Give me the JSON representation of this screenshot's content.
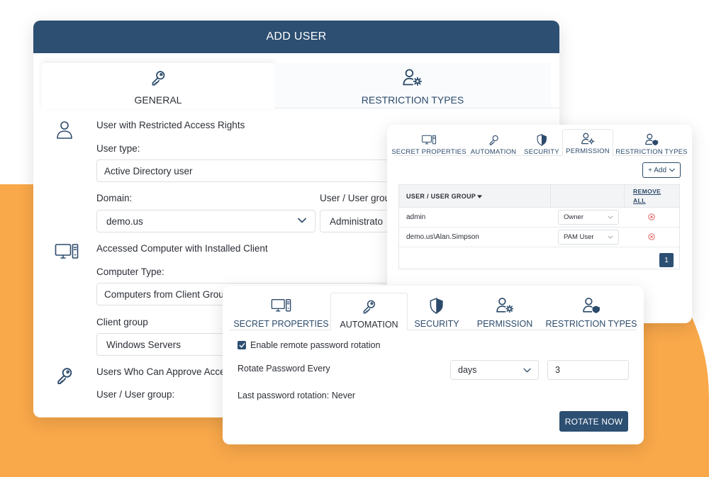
{
  "add_user": {
    "title": "ADD USER",
    "tabs": [
      {
        "label": "GENERAL",
        "icon": "key-icon",
        "active": true
      },
      {
        "label": "RESTRICTION TYPES",
        "icon": "user-gear-icon",
        "active": false
      }
    ],
    "section_user": {
      "heading": "User with Restricted Access Rights",
      "user_type_label": "User type:",
      "user_type_value": "Active Directory user",
      "domain_label": "Domain:",
      "domain_value": "demo.us",
      "user_group_label": "User / User grou",
      "user_group_value": "Administrato"
    },
    "section_computer": {
      "heading": "Accessed Computer with Installed Client",
      "computer_type_label": "Computer Type:",
      "computer_type_value": "Computers from Client Grou",
      "client_group_label": "Client group",
      "client_group_value": "Windows Servers"
    },
    "section_approvers": {
      "heading": "Users Who Can Approve Acce",
      "user_group_label": "User / User group:"
    }
  },
  "permissions": {
    "tabs": [
      {
        "label": "SECRET PROPERTIES",
        "icon": "computer-icon"
      },
      {
        "label": "AUTOMATION",
        "icon": "key-icon"
      },
      {
        "label": "SECURITY",
        "icon": "shield-icon"
      },
      {
        "label": "PERMISSION",
        "icon": "user-gear-icon"
      },
      {
        "label": "RESTRICTION TYPES",
        "icon": "user-shield-icon"
      }
    ],
    "active_tab": "PERMISSION",
    "add_label": "+ Add",
    "table": {
      "col_user": "USER / USER GROUP",
      "remove_all_line1": "REMOVE",
      "remove_all_line2": "ALL",
      "rows": [
        {
          "user": "admin",
          "role": "Owner"
        },
        {
          "user": "demo.us\\Alan.Simpson",
          "role": "PAM User"
        }
      ]
    },
    "page": "1"
  },
  "automation": {
    "tabs": [
      {
        "label": "SECRET PROPERTIES",
        "icon": "computer-icon"
      },
      {
        "label": "AUTOMATION",
        "icon": "key-icon"
      },
      {
        "label": "SECURITY",
        "icon": "shield-icon"
      },
      {
        "label": "PERMISSION",
        "icon": "user-gear-icon"
      },
      {
        "label": "RESTRICTION TYPES",
        "icon": "user-shield-icon"
      }
    ],
    "active_tab": "AUTOMATION",
    "enable_rotation_label": "Enable remote password rotation",
    "enable_rotation_checked": true,
    "rotate_every_label": "Rotate Password Every",
    "interval_unit": "days",
    "interval_value": "3",
    "last_rotation": "Last password rotation: Never",
    "rotate_now_label": "ROTATE NOW"
  },
  "colors": {
    "header": "#2c4f72",
    "accent_orange": "#f9a84a",
    "icon": "#2c4a6b",
    "remove": "#e05252"
  }
}
